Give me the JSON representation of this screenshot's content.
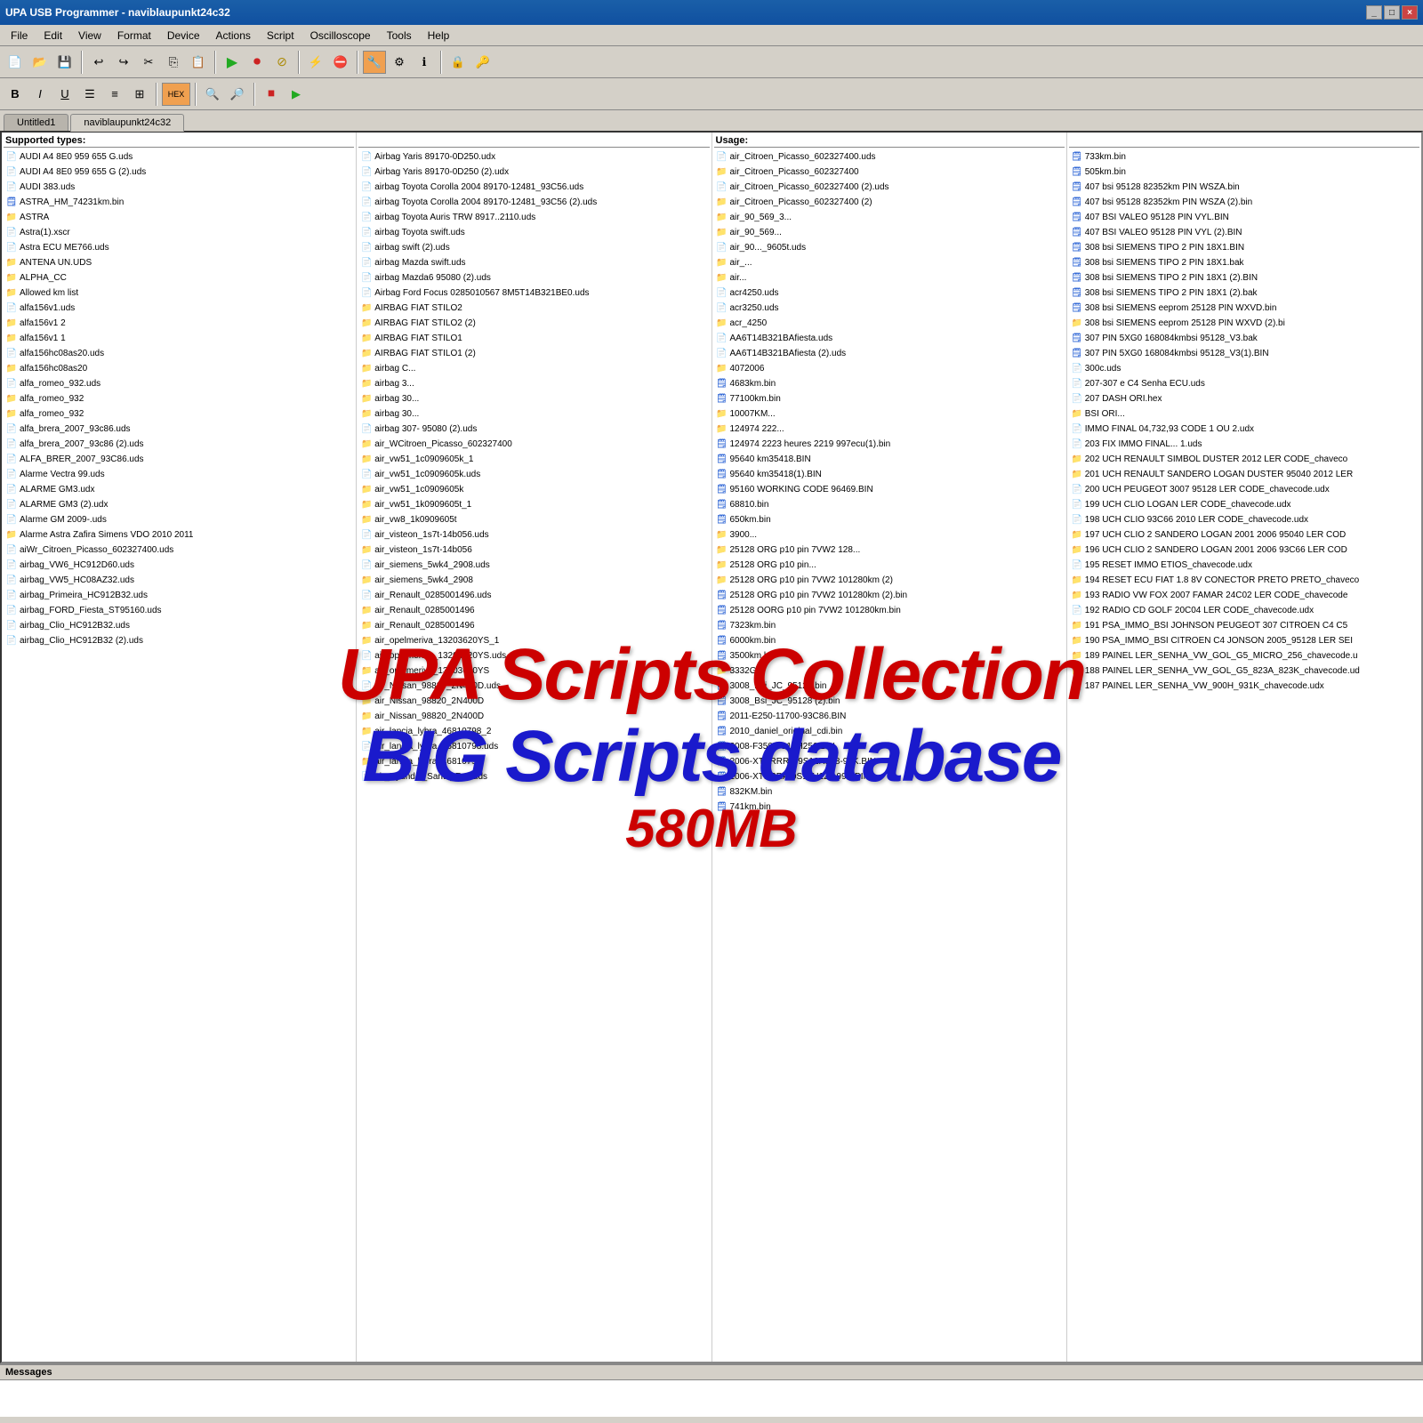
{
  "titleBar": {
    "text": "UPA USB Programmer - naviblaupunkt24c32",
    "buttons": [
      "_",
      "□",
      "×"
    ]
  },
  "menuBar": {
    "items": [
      "File",
      "Edit",
      "View",
      "Format",
      "Device",
      "Actions",
      "Script",
      "Oscilloscope",
      "Tools",
      "Help"
    ]
  },
  "tabs": [
    {
      "label": "Untitled1",
      "active": false
    },
    {
      "label": "naviblaupunkt24c32",
      "active": true
    }
  ],
  "columns": {
    "headers": [
      "Supported types:",
      "",
      "Usage:",
      ""
    ]
  },
  "col1": [
    "AUDI A4 8E0 959 655 G.uds",
    "AUDI A4 8E0 959 655 G (2).uds",
    "AUDI 383.uds",
    "ASTRA_HM_74231km.bin",
    "ASTRA",
    "Astra(1).xscr",
    "Astra ECU ME766.uds",
    "ANTENA UN.UDS",
    "ALPHA_CC",
    "Allowed km list",
    "alfa156v1.uds",
    "alfa156v1 2",
    "alfa156v1 1",
    "alfa156hc08as20.uds",
    "alfa156hc08as20",
    "alfa_romeo_932.uds",
    "alfa_romeo_932",
    "alfa_romeo_932",
    "alfa_brera_2007_93c86.uds",
    "alfa_brera_2007_93c86 (2).uds",
    "ALFA_BRER_2007_93C86.uds",
    "Alarme Vectra 99.uds",
    "ALARME GM3.udx",
    "ALARME GM3 (2).udx",
    "Alarme GM 2009-.uds",
    "Alarme Astra Zafira Simens VDO 2010 2011",
    "aiWr_Citroen_Picasso_602327400.uds",
    "airbag_VW6_HC912D60.uds",
    "airbag_VW5_HC08AZ32.uds",
    "airbag_Primeira_HC912B32.uds",
    "airbag_FORD_Fiesta_ST95160.uds",
    "airbag_Clio_HC912B32.uds",
    "airbag_Clio_HC912B32 (2).uds"
  ],
  "col2": [
    "Airbag Yaris 89170-0D250.udx",
    "Airbag Yaris 89170-0D250 (2).udx",
    "airbag Toyota Corolla 2004 89170-12481_93C56.uds",
    "airbag Toyota Corolla 2004 89170-12481_93C56 (2).uds",
    "airbag Toyota Auris TRW 8917..2110.uds",
    "airbag Toyota swift.uds",
    "airbag swift (2).uds",
    "airbag Mazda swift.uds",
    "airbag Mazda6 95080 (2).uds",
    "Airbag Ford Focus 0285010567 8M5T14B321BE0.uds",
    "AIRBAG FIAT STILO2",
    "AIRBAG FIAT STILO2 (2)",
    "AIRBAG FIAT STILO1",
    "AIRBAG FIAT STILO1 (2)",
    "airbag C...",
    "airbag 3...",
    "airbag 30...",
    "airbag 30...",
    "airbag 307- 95080 (2).uds",
    "air_WCitroen_Picasso_602327400",
    "air_vw51_1c0909605k_1",
    "air_vw51_1c0909605k.uds",
    "air_vw51_1c0909605k",
    "air_vw51_1k0909605t_1",
    "air_vw8_1k0909605t",
    "air_visteon_1s7t-14b056.uds",
    "air_visteon_1s7t-14b056",
    "air_siemens_5wk4_2908.uds",
    "air_siemens_5wk4_2908",
    "air_Renault_0285001496.uds",
    "air_Renault_0285001496",
    "air_Renault_0285001496",
    "air_opelmeriva_13203620YS_1",
    "air_opelmeriva_13203620YS.uds",
    "air_opelmeriva_13203620YS",
    "air_Nissan_98820_2N400D.uds",
    "air_Nissan_98820_2N400D",
    "air_Nissan_98820_2N400D",
    "air_lancia_lybra_46810798_2",
    "air_lancia_lybra_46810798.uds",
    "air_lancia_lybra_46810798",
    "air_Hyundai_Santa_Fe1.uds"
  ],
  "col3": [
    "air_Citroen_Picasso_602327400.uds",
    "air_Citroen_Picasso_602327400",
    "air_Citroen_Picasso_602327400 (2).uds",
    "air_Citroen_Picasso_602327400 (2)",
    "air_90_569_3...",
    "air_90_569...",
    "air_90..._9605t.uds",
    "air_...",
    "air...",
    "acr4250.uds",
    "acr3250.uds",
    "acr_4250",
    "AA6T14B321BAfiesta.uds",
    "AA6T14B321BAfiesta (2).uds",
    "4072006",
    "4683km.bin",
    "77100km.bin",
    "10007KM...",
    "124974  222...",
    "124974  2223 heures 2219 997ecu(1).bin",
    "95640 km35418.BIN",
    "95640 km35418(1).BIN",
    "95160 WORKING CODE 96469.BIN",
    "68810.bin",
    "650km.bin",
    "3900...",
    "25128 ORG p10 pin 7VW2 128...",
    "25128 ORG p10 pin...",
    "25128 ORG p10 pin 7VW2 101280km (2)",
    "25128 ORG p10 pin 7VW2 101280km (2).bin",
    "25128 OORG p10 pin 7VW2 101280km.bin",
    "7323km.bin",
    "6000km.bin",
    "3500km.bin",
    "3332G",
    "3008_Bsi_JC_95128.bin",
    "3008_Bsi_JC_95128 (2).bin",
    "2011-E250-11700-93C86.BIN",
    "2010_daniel_original_cdi.bin",
    "2008-F350-9S12H256.BIN",
    "2006-XTERRRA-9S12H128-99K.BIN",
    "2006-XTERRA-9S12H128-99K.BIN",
    "832KM.bin",
    "741km.bin"
  ],
  "col4": [
    "733km.bin",
    "505km.bin",
    "407 bsi 95128 82352km PIN WSZA.bin",
    "407 bsi 95128 82352km PIN WSZA (2).bin",
    "407 BSI VALEO 95128 PIN VYL.BIN",
    "407 BSI VALEO 95128 PIN VYL (2).BIN",
    "308 bsi SIEMENS TIPO 2 PIN 18X1.BIN",
    "308 bsi SIEMENS TIPO 2 PIN 18X1.bak",
    "308 bsi SIEMENS TIPO 2 PIN 18X1 (2).BIN",
    "308 bsi SIEMENS TIPO 2 PIN 18X1 (2).bak",
    "308 bsi SIEMENS eeprom 25128 PIN WXVD.bin",
    "308 bsi SIEMENS eeprom 25128 PIN WXVD (2).bi",
    "307 PIN 5XG0 168084kmbsi 95128_V3.bak",
    "307 PIN 5XG0 168084kmbsi 95128_V3(1).BIN",
    "300c.uds",
    "207-307 e C4 Senha ECU.uds",
    "207 DASH ORI.hex",
    "BSI ORI...",
    "IMMO FINAL 04,732,93 CODE 1 OU 2.udx",
    "203 FIX IMMO FINAL... 1.uds",
    "202 UCH RENAULT SIMBOL DUSTER 2012 LER CODE_chaveco",
    "201 UCH RENAULT SANDERO LOGAN DUSTER 95040 2012 LER",
    "200 UCH PEUGEOT 3007 95128 LER CODE_chavecode.udx",
    "199 UCH CLIO LOGAN  LER CODE_chavecode.udx",
    "198 UCH CLIO 93C66 2010 LER CODE_chavecode.udx",
    "197 UCH CLIO 2 SANDERO LOGAN 2001 2006 95040 LER COD",
    "196 UCH CLIO 2 SANDERO LOGAN 2001 2006 93C66 LER COD",
    "195 RESET IMMO ETIOS_chavecode.udx",
    "194 RESET ECU FIAT 1.8 8V CONECTOR PRETO PRETO_chaveco",
    "193 RADIO VW FOX 2007 FAMAR 24C02 LER CODE_chavecode",
    "192 RADIO CD GOLF 20C04 LER CODE_chavecode.udx",
    "191 PSA_IMMO_BSI JOHNSON PEUGEOT 307 CITROEN C4 C5",
    "190 PSA_IMMO_BSI CITROEN C4 JONSON 2005_95128 LER SEI",
    "189 PAINEL LER_SENHA_VW_GOL_G5_MICRO_256_chavecode.u",
    "188 PAINEL LER_SENHA_VW_GOL_G5_823A_823K_chavecode.ud",
    "187 PAINEL LER_SENHA_VW_900H_931K_chavecode.udx"
  ],
  "watermark": {
    "line1": "UPA Scripts Collection",
    "line2": "BIG Scripts database",
    "line3": "580MB"
  },
  "messages": {
    "header": "Messages"
  }
}
